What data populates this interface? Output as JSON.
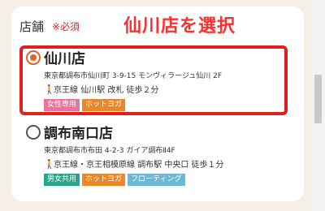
{
  "field": {
    "label": "店舗",
    "required": "※必須"
  },
  "banner": "仙川店を選択",
  "stores": [
    {
      "name": "仙川店",
      "address": "東京都調布市仙川町 3-9-15 モンヴィラージュ仙川 2F",
      "access": "京王線 仙川駅 改札 徒歩２分",
      "tags": [
        "女性専用",
        "ホットヨガ"
      ],
      "selected": true
    },
    {
      "name": "調布南口店",
      "address": "東京都調布市布田 4-2-3 ガイア調布Ⅱ4F",
      "access": "京王線・京王相模原線 調布駅 中央口 徒歩１分",
      "tags": [
        "男女共用",
        "ホットヨガ",
        "フローティング"
      ],
      "selected": false
    }
  ],
  "colors": {
    "accent": "#e02020",
    "radio_selected": "#e0622a"
  }
}
